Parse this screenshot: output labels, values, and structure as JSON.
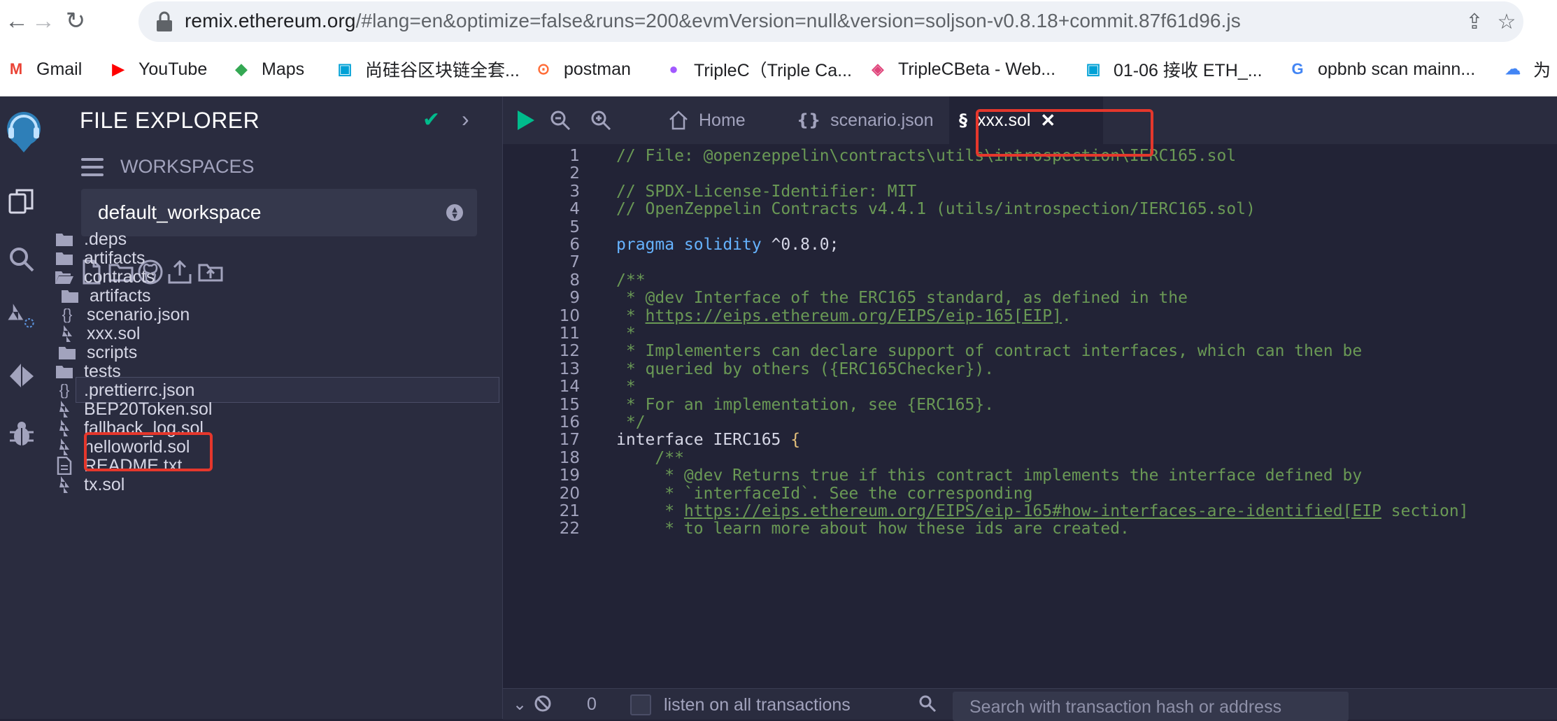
{
  "browser": {
    "url_host": "remix.ethereum.org",
    "url_rest": "/#lang=en&optimize=false&runs=200&evmVersion=null&version=soljson-v0.8.18+commit.87f61d96.js",
    "bookmarks": [
      {
        "label": "Gmail",
        "icon": "gmail-icon",
        "color": "#ea4335"
      },
      {
        "label": "YouTube",
        "icon": "youtube-icon",
        "color": "#ff0000"
      },
      {
        "label": "Maps",
        "icon": "maps-icon",
        "color": "#34a853"
      },
      {
        "label": "尚硅谷区块链全套...",
        "icon": "bilibili-icon",
        "color": "#00a1d6"
      },
      {
        "label": "postman",
        "icon": "postman-icon",
        "color": "#ff6c37"
      },
      {
        "label": "TripleC（Triple Ca...",
        "icon": "figma-icon",
        "color": "#a259ff"
      },
      {
        "label": "TripleCBeta - Web...",
        "icon": "tripleC-icon",
        "color": "#e0457b"
      },
      {
        "label": "01-06 接收 ETH_...",
        "icon": "bilibili-icon",
        "color": "#00a1d6"
      },
      {
        "label": "opbnb scan mainn...",
        "icon": "google-icon",
        "color": "#4285f4"
      },
      {
        "label": "为",
        "icon": "cloud-icon",
        "color": "#4285f4"
      }
    ]
  },
  "sidebar": {
    "title": "FILE EXPLORER",
    "workspaces_label": "WORKSPACES",
    "workspace": "default_workspace",
    "tree": [
      {
        "label": ".deps",
        "icon": "folder-icon",
        "glyph": "▬"
      },
      {
        "label": "artifacts",
        "icon": "folder-icon",
        "glyph": "▬"
      },
      {
        "label": "contracts",
        "icon": "folder-open-icon",
        "glyph": "▭"
      },
      {
        "label": "artifacts",
        "icon": "folder-icon",
        "glyph": "▬"
      },
      {
        "label": "scenario.json",
        "icon": "json-icon",
        "glyph": "{}"
      },
      {
        "label": "xxx.sol",
        "icon": "solidity-icon",
        "glyph": "§"
      },
      {
        "label": "scripts",
        "icon": "folder-icon",
        "glyph": "▬"
      },
      {
        "label": "tests",
        "icon": "folder-icon",
        "glyph": "▬"
      },
      {
        "label": ".prettierrc.json",
        "icon": "json-icon",
        "glyph": "{}"
      },
      {
        "label": "BEP20Token.sol",
        "icon": "solidity-icon",
        "glyph": "§"
      },
      {
        "label": "fallback_log.sol",
        "icon": "solidity-icon",
        "glyph": "§"
      },
      {
        "label": "helloworld.sol",
        "icon": "solidity-icon",
        "glyph": "§"
      },
      {
        "label": "README.txt",
        "icon": "file-text-icon",
        "glyph": "▤"
      },
      {
        "label": "tx.sol",
        "icon": "solidity-icon",
        "glyph": "§"
      }
    ]
  },
  "tabs": [
    {
      "label": "Home",
      "icon": "home-icon",
      "glyph": "⌂"
    },
    {
      "label": "scenario.json",
      "icon": "json-icon",
      "glyph": "{}"
    },
    {
      "label": "xxx.sol",
      "icon": "solidity-icon",
      "glyph": "§",
      "close": "✕"
    }
  ],
  "code_lines": [
    {
      "n": "1",
      "t": "// File: @openzeppelin\\contracts\\utils\\introspection\\IERC165.sol",
      "k": "comment"
    },
    {
      "n": "2",
      "t": "",
      "k": "plain"
    },
    {
      "n": "3",
      "t": "// SPDX-License-Identifier: MIT",
      "k": "comment"
    },
    {
      "n": "4",
      "t": "// OpenZeppelin Contracts v4.4.1 (utils/introspection/IERC165.sol)",
      "k": "comment"
    },
    {
      "n": "5",
      "t": "",
      "k": "plain"
    },
    {
      "n": "6",
      "t": "pragma solidity ^0.8.0;",
      "k": "pragma"
    },
    {
      "n": "7",
      "t": "",
      "k": "plain"
    },
    {
      "n": "8",
      "t": "/**",
      "k": "comment"
    },
    {
      "n": "9",
      "t": " * @dev Interface of the ERC165 standard, as defined in the",
      "k": "comment"
    },
    {
      "n": "10",
      "t": " * https://eips.ethereum.org/EIPS/eip-165[EIP].",
      "k": "url"
    },
    {
      "n": "11",
      "t": " *",
      "k": "comment"
    },
    {
      "n": "12",
      "t": " * Implementers can declare support of contract interfaces, which can then be",
      "k": "comment"
    },
    {
      "n": "13",
      "t": " * queried by others ({ERC165Checker}).",
      "k": "comment"
    },
    {
      "n": "14",
      "t": " *",
      "k": "comment"
    },
    {
      "n": "15",
      "t": " * For an implementation, see {ERC165}.",
      "k": "comment"
    },
    {
      "n": "16",
      "t": " */",
      "k": "comment"
    },
    {
      "n": "17",
      "t": "interface IERC165 {",
      "k": "interface"
    },
    {
      "n": "18",
      "t": "    /**",
      "k": "comment"
    },
    {
      "n": "19",
      "t": "     * @dev Returns true if this contract implements the interface defined by",
      "k": "comment"
    },
    {
      "n": "20",
      "t": "     * `interfaceId`. See the corresponding",
      "k": "comment"
    },
    {
      "n": "21",
      "t": "     * https://eips.ethereum.org/EIPS/eip-165#how-interfaces-are-identified[EIP section]",
      "k": "url"
    },
    {
      "n": "22",
      "t": "     * to learn more about how these ids are created.",
      "k": "comment"
    }
  ],
  "terminal": {
    "count": "0",
    "listen_label": "listen on all transactions",
    "search_placeholder": "Search with transaction hash or address"
  },
  "colors": {
    "accent": "#00bc8c",
    "highlight": "#e5372c",
    "bg": "#222336",
    "panel": "#2a2c3f"
  }
}
